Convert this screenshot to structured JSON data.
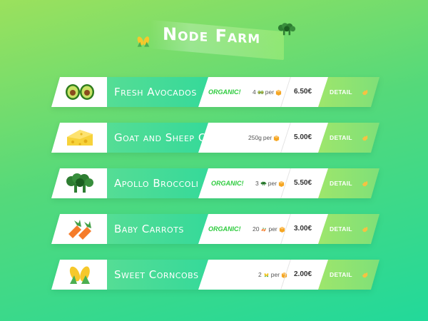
{
  "header": {
    "title": "Node Farm",
    "left_icon": "corn-icon",
    "right_icon": "broccoli-icon"
  },
  "products": [
    {
      "icon": "avocado-icon",
      "name": "Fresh Avocados",
      "organic": "ORGANIC!",
      "quantity": "4",
      "per": "per",
      "unit_icon": "avocado-icon",
      "price": "6.50€",
      "detail": "DETAIL"
    },
    {
      "icon": "cheese-icon",
      "name": "Goat and Sheep Cheese",
      "organic": "",
      "quantity": "250g",
      "per": "per",
      "unit_icon": "",
      "price": "5.00€",
      "detail": "DETAIL"
    },
    {
      "icon": "broccoli-icon",
      "name": "Apollo Broccoli",
      "organic": "ORGANIC!",
      "quantity": "3",
      "per": "per",
      "unit_icon": "broccoli-icon",
      "price": "5.50€",
      "detail": "DETAIL"
    },
    {
      "icon": "carrot-icon",
      "name": "Baby Carrots",
      "organic": "ORGANIC!",
      "quantity": "20",
      "per": "per",
      "unit_icon": "carrot-icon",
      "price": "3.00€",
      "detail": "DETAIL"
    },
    {
      "icon": "corn-icon",
      "name": "Sweet Corncobs",
      "organic": "",
      "quantity": "2",
      "per": "per",
      "unit_icon": "corn-icon",
      "price": "2.00€",
      "detail": "DETAIL"
    }
  ]
}
